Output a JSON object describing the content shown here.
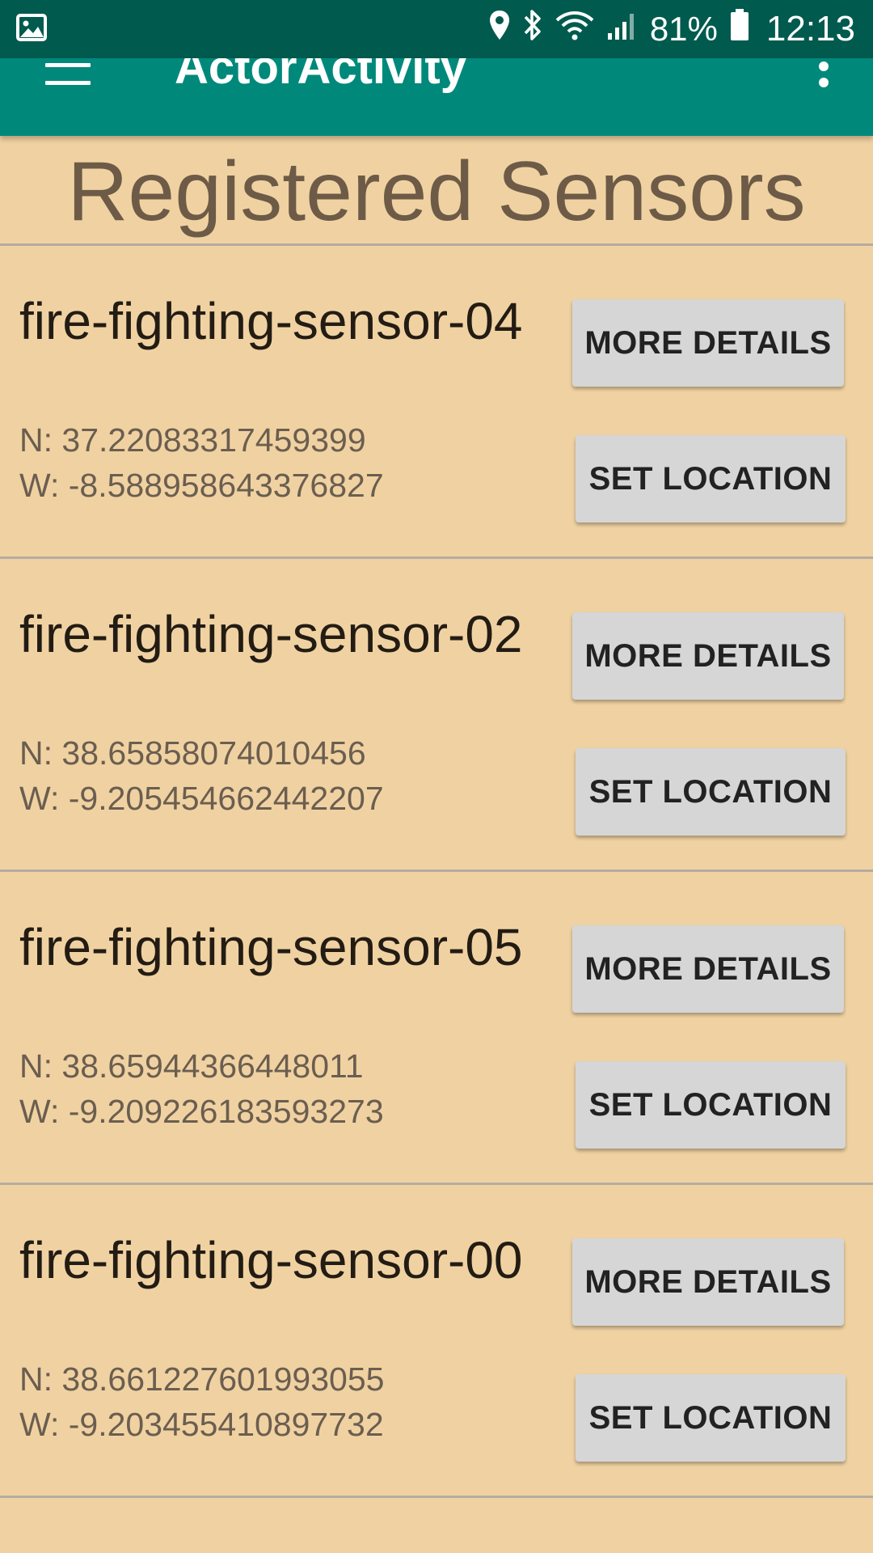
{
  "status_bar": {
    "battery": "81%",
    "time": "12:13",
    "icons": [
      "image-icon",
      "location-icon",
      "bluetooth-icon",
      "wifi-icon",
      "signal-icon",
      "battery-icon"
    ]
  },
  "app_bar": {
    "title": "ActorActivity"
  },
  "section": {
    "title": "Registered Sensors"
  },
  "sensors": [
    {
      "name": "fire-fighting-sensor-04",
      "n": "N: 37.22083317459399",
      "w": "W: -8.588958643376827",
      "details_label": "MORE DETAILS",
      "location_label": "SET LOCATION"
    },
    {
      "name": "fire-fighting-sensor-02",
      "n": "N: 38.65858074010456",
      "w": "W: -9.205454662442207",
      "details_label": "MORE DETAILS",
      "location_label": "SET LOCATION"
    },
    {
      "name": "fire-fighting-sensor-05",
      "n": "N: 38.65944366448011",
      "w": "W: -9.209226183593273",
      "details_label": "MORE DETAILS",
      "location_label": "SET LOCATION"
    },
    {
      "name": "fire-fighting-sensor-00",
      "n": "N: 38.661227601993055",
      "w": "W: -9.203455410897732",
      "details_label": "MORE DETAILS",
      "location_label": "SET LOCATION"
    }
  ],
  "colors": {
    "status_bar": "#005a4e",
    "app_bar": "#00897b",
    "background": "#f0d2a2",
    "button": "#d6d6d6"
  }
}
